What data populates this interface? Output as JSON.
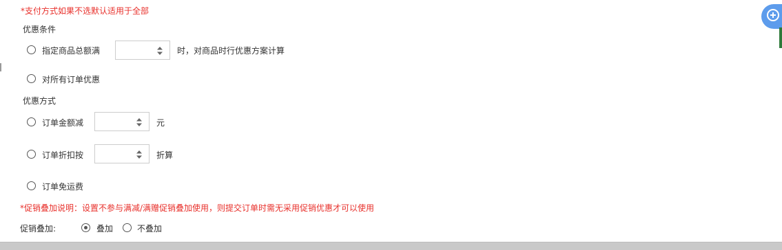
{
  "notes": {
    "payment_note": "*支付方式如果不选默认适用于全部",
    "stack_note": "*促销叠加说明：设置不参与满减/满赠促销叠加使用，则提交订单时需无采用促销优惠才可以使用"
  },
  "condition": {
    "title": "优惠条件",
    "options": [
      {
        "label": "指定商品总额满",
        "suffix": "时，对商品时行优惠方案计算",
        "value": "",
        "selected": false
      },
      {
        "label": "对所有订单优惠",
        "selected": false
      }
    ]
  },
  "method": {
    "title": "优惠方式",
    "options": [
      {
        "label": "订单金额减",
        "suffix": "元",
        "value": "",
        "selected": false
      },
      {
        "label": "订单折扣按",
        "suffix": "折算",
        "value": "",
        "selected": false
      },
      {
        "label": "订单免运费",
        "selected": false
      }
    ]
  },
  "stacking": {
    "label": "促销叠加:",
    "options": [
      {
        "label": "叠加",
        "selected": true
      },
      {
        "label": "不叠加",
        "selected": false
      }
    ]
  },
  "floating_button": {
    "icon": "plus-circle-icon",
    "color": "#5d9cec"
  },
  "colors": {
    "note_red": "#e8302b"
  }
}
